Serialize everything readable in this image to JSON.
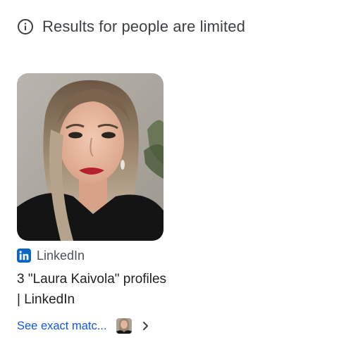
{
  "notice": {
    "icon": "info-icon",
    "text": "Results for people are limited"
  },
  "result": {
    "image_icon": "person-photo",
    "source": {
      "logo": "linkedin-logo-icon",
      "name": "LinkedIn",
      "brand_color": "#0a66c2"
    },
    "title": "3 \"Laura Kaivola\" profiles | LinkedIn",
    "exact_match_label": "See exact matc...",
    "exact_match_thumb": "person-thumbnail",
    "chevron": "chevron-right-icon"
  },
  "colors": {
    "link": "#1558d6",
    "text_primary": "#202124",
    "text_secondary": "#4d5156"
  }
}
